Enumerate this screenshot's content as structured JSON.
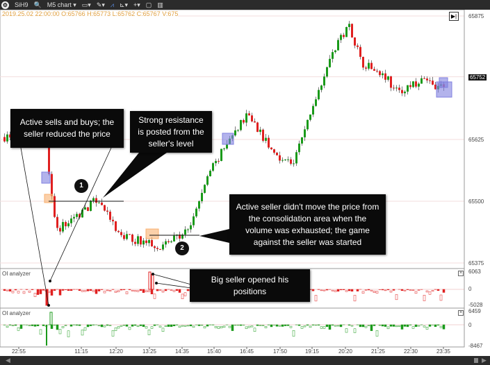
{
  "toolbar": {
    "symbol": "SiH9",
    "chart_type": "M5 chart",
    "icons": [
      "logo-icon",
      "search-icon",
      "monitor-icon",
      "pen-icon",
      "chart-icon",
      "indicator-icon",
      "crosshair-icon",
      "window-icon",
      "layout-icon"
    ]
  },
  "ohlc_line": "2019.25.02 22:00:00 O:65766 H:65773 L:65762 C:65767 V:675",
  "price_scale": [
    "65875",
    "65752",
    "65625",
    "65500",
    "65375"
  ],
  "current_price": "65752",
  "panels": [
    {
      "title": "OI analyzer",
      "max": "6063",
      "zero": "0",
      "min": "-5028",
      "color": "#e02020"
    },
    {
      "title": "OI analyzer",
      "max": "6459",
      "zero": "0",
      "min": "-8467",
      "color": "#22a022"
    }
  ],
  "time_labels": [
    "22:55",
    "11:15",
    "12:20",
    "13:25",
    "14:35",
    "15:40",
    "16:45",
    "17:50",
    "19:15",
    "20:20",
    "21:25",
    "22:30",
    "23:35"
  ],
  "callouts": {
    "c1": "Active sells and buys; the seller reduced the price",
    "c2": "Strong resistance is posted from the seller's level",
    "c3": "Active seller didn't move the price from the consolidation area when the volume was exhausted; the game against the seller was started",
    "c4": "Big seller opened his positions"
  },
  "markers": [
    "1",
    "2"
  ],
  "colors": {
    "up": "#1a9a1a",
    "down": "#e02020",
    "toolbar": "#2b2b2b",
    "ohlc": "#e0a040",
    "box": "#8080e0"
  }
}
